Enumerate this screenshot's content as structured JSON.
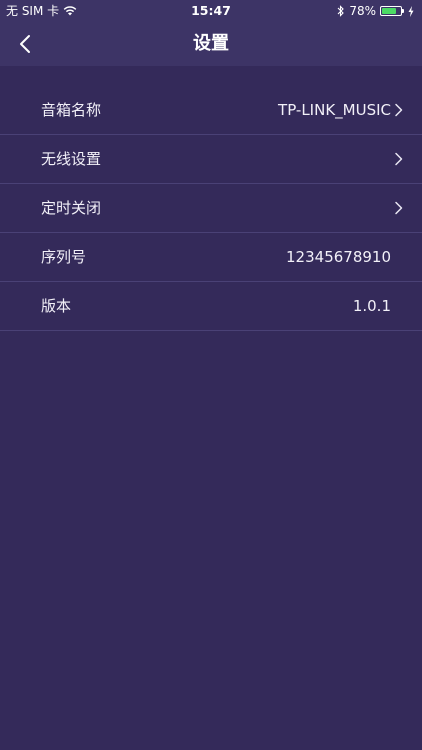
{
  "status_bar": {
    "carrier": "无 SIM 卡",
    "time": "15:47",
    "battery_percent": "78%",
    "battery_level": 0.78,
    "icons": [
      "wifi-icon",
      "bluetooth-icon",
      "battery-icon",
      "charging-bolt-icon"
    ]
  },
  "navbar": {
    "title": "设置",
    "back_icon": "chevron-left-icon"
  },
  "settings": [
    {
      "label": "音箱名称",
      "value": "TP-LINK_MUSIC",
      "has_chevron": true
    },
    {
      "label": "无线设置",
      "value": "",
      "has_chevron": true
    },
    {
      "label": "定时关闭",
      "value": "",
      "has_chevron": true
    },
    {
      "label": "序列号",
      "value": "12345678910",
      "has_chevron": false
    },
    {
      "label": "版本",
      "value": "1.0.1",
      "has_chevron": false
    }
  ],
  "colors": {
    "background": "#342a5a",
    "header": "#3d3466",
    "divider": "#4a4176",
    "battery_fill": "#4cd964"
  }
}
